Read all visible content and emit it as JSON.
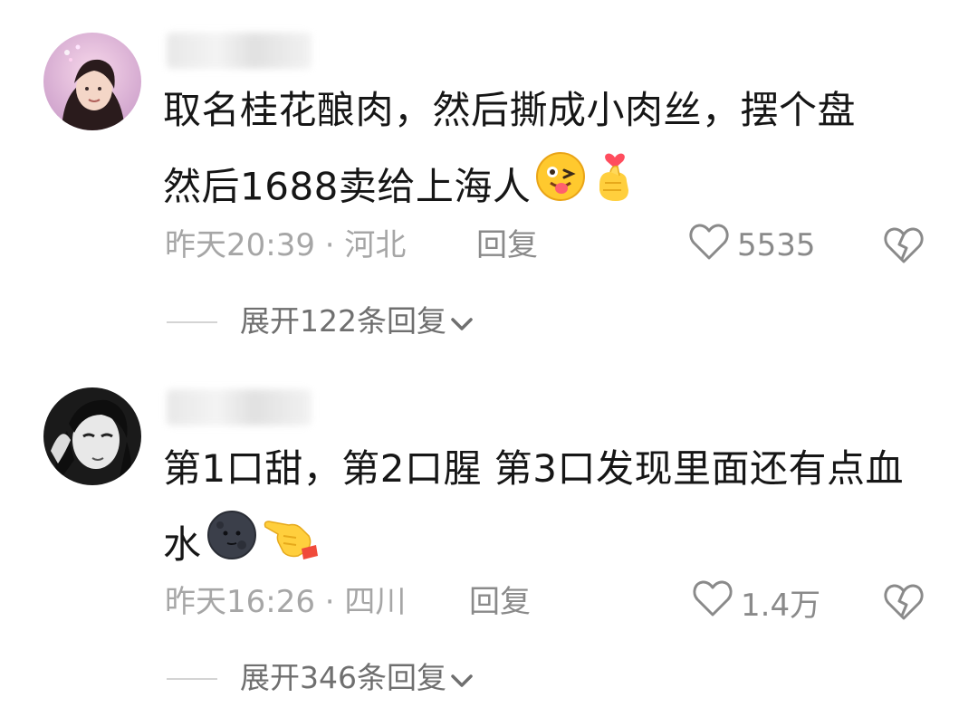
{
  "comments": [
    {
      "text_line1": "取名桂花酿肉，然后撕成小肉丝，摆个盘",
      "text_line2": "然后1688卖给上海人",
      "emojis": [
        "tongue-wink-emoji",
        "finger-heart-emoji"
      ],
      "time_location": "昨天20:39 · 河北",
      "reply_label": "回复",
      "likes": "5535",
      "expand_label": "展开122条回复"
    },
    {
      "text_line1": "第1口甜，第2口腥 第3口发现里面还有点血",
      "text_line2": "水",
      "emojis": [
        "dark-moon-face-emoji",
        "pointing-hand-emoji"
      ],
      "time_location": "昨天16:26 · 四川",
      "reply_label": "回复",
      "likes": "1.4万",
      "expand_label": "展开346条回复"
    }
  ],
  "colors": {
    "text": "#161616",
    "meta": "#a6a6a6",
    "secondary": "#8a8a8a",
    "expand": "#6f6f6f"
  }
}
